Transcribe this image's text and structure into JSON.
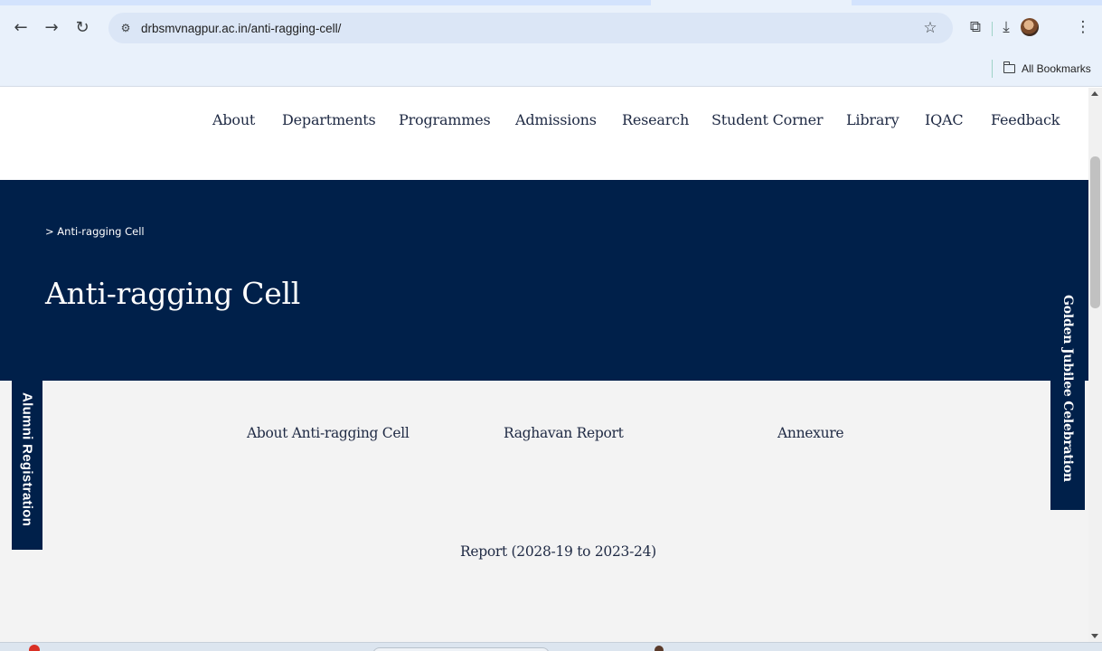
{
  "browser": {
    "url": "drbsmvnagpur.ac.in/anti-ragging-cell/",
    "icons": {
      "back": "←",
      "forward": "→",
      "reload": "↻",
      "site_info": "⚙",
      "bookmark_star": "☆",
      "extensions": "⧉",
      "downloads": "⤓",
      "menu": "⋮"
    },
    "bookmarks_bar": {
      "all_bookmarks": "All Bookmarks"
    }
  },
  "site_nav": {
    "items": [
      {
        "label": "About"
      },
      {
        "label": "Departments"
      },
      {
        "label": "Programmes"
      },
      {
        "label": "Admissions"
      },
      {
        "label": "Research"
      },
      {
        "label": "Student Corner"
      },
      {
        "label": "Library"
      },
      {
        "label": "IQAC"
      },
      {
        "label": "Feedback"
      }
    ]
  },
  "hero": {
    "breadcrumb": "> Anti-ragging Cell",
    "title": "Anti-ragging Cell",
    "background": "#00204a"
  },
  "content": {
    "tabs": [
      {
        "label": "About Anti-ragging Cell"
      },
      {
        "label": "Raghavan Report"
      },
      {
        "label": "Annexure"
      }
    ],
    "report_link": "Report (2028-19 to 2023-24)"
  },
  "floating_tabs": {
    "alumni": "Alumni Registration",
    "jubilee": "Golden Jubilee Celebration"
  }
}
